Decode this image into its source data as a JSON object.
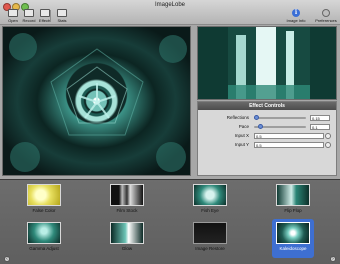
{
  "window": {
    "title": "ImageLobe"
  },
  "toolbar": {
    "left": [
      {
        "label": "Open",
        "icon": "open-icon"
      },
      {
        "label": "Record",
        "icon": "record-icon"
      },
      {
        "label": "Effects",
        "icon": "effects-icon"
      },
      {
        "label": "Stats",
        "icon": "stats-icon"
      }
    ],
    "right": [
      {
        "label": "Image Info",
        "icon": "info-icon"
      },
      {
        "label": "Preferences",
        "icon": "preferences-icon"
      }
    ]
  },
  "effect_controls": {
    "title": "Effect Controls",
    "rows": [
      {
        "label": "Reflections",
        "value": "0.15",
        "slider_fraction": 0.0
      },
      {
        "label": "Pace",
        "value": "0.1",
        "slider_fraction": 0.1
      }
    ],
    "inputs": [
      {
        "label": "Input X",
        "value": "0.5"
      },
      {
        "label": "Input Y",
        "value": "0.5"
      }
    ]
  },
  "effects_browser": {
    "row1": [
      {
        "label": "False Color"
      },
      {
        "label": "Film Stock"
      },
      {
        "label": "Fish Eye"
      },
      {
        "label": "Flip Flop"
      }
    ],
    "row2": [
      {
        "label": "Gamma Adjust"
      },
      {
        "label": "Glow"
      },
      {
        "label": "Image Restore"
      },
      {
        "label": "Kaleidoscope",
        "selected": true
      }
    ]
  },
  "colors": {
    "accent": "#3e6fd1",
    "window_bg": "#a7a7a7",
    "browser_bg": "#666666"
  }
}
